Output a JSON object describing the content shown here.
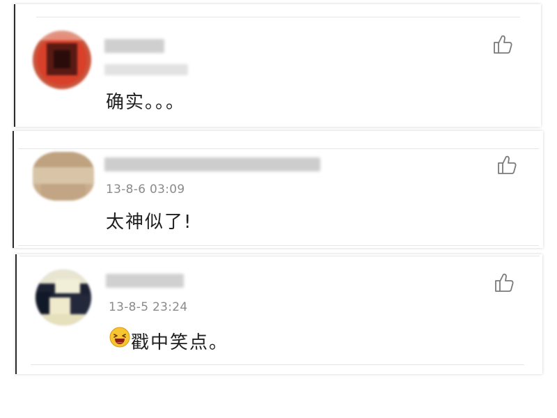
{
  "comments": [
    {
      "username": "",
      "timestamp": "",
      "text": "确实。。。",
      "like_icon": "thumbs-up-icon"
    },
    {
      "username": "",
      "timestamp": "13-8-6 03:09",
      "text": "太神似了!",
      "like_icon": "thumbs-up-icon"
    },
    {
      "username": "",
      "timestamp": "13-8-5 23:24",
      "text": "戳中笑点。",
      "emoji": "laughing-emoji-icon",
      "like_icon": "thumbs-up-icon"
    }
  ],
  "colors": {
    "accent": "#f0a01e",
    "text": "#1f1f1f",
    "timestamp": "#8a8a8a",
    "icon": "#7a7a7a"
  }
}
